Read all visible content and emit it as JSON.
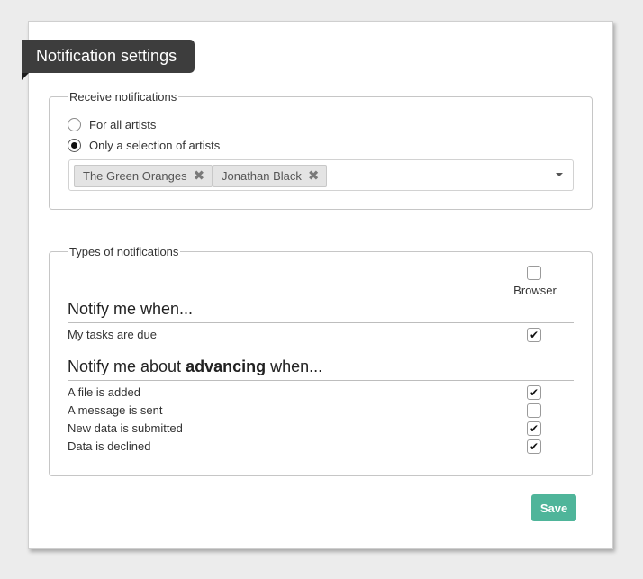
{
  "header": {
    "title": "Notification settings"
  },
  "receive": {
    "legend": "Receive notifications",
    "options": [
      {
        "label": "For all artists",
        "selected": false
      },
      {
        "label": "Only a selection of artists",
        "selected": true
      }
    ],
    "selected_artists": [
      "The Green Oranges",
      "Jonathan Black"
    ],
    "remove_glyph": "✖"
  },
  "types": {
    "legend": "Types of notifications",
    "column_header": "Browser",
    "column_header_checked": false,
    "group1": {
      "title": "Notify me when...",
      "rows": [
        {
          "label": "My tasks are due",
          "browser": true
        }
      ]
    },
    "group2": {
      "title_pre": "Notify me about ",
      "title_bold": "advancing",
      "title_post": " when...",
      "rows": [
        {
          "label": "A file is added",
          "browser": true
        },
        {
          "label": "A message is sent",
          "browser": false
        },
        {
          "label": "New data is submitted",
          "browser": true
        },
        {
          "label": "Data is declined",
          "browser": true
        }
      ]
    }
  },
  "actions": {
    "save_label": "Save"
  },
  "colors": {
    "accent": "#4fb59a",
    "header_bg": "#3d3d3d"
  }
}
